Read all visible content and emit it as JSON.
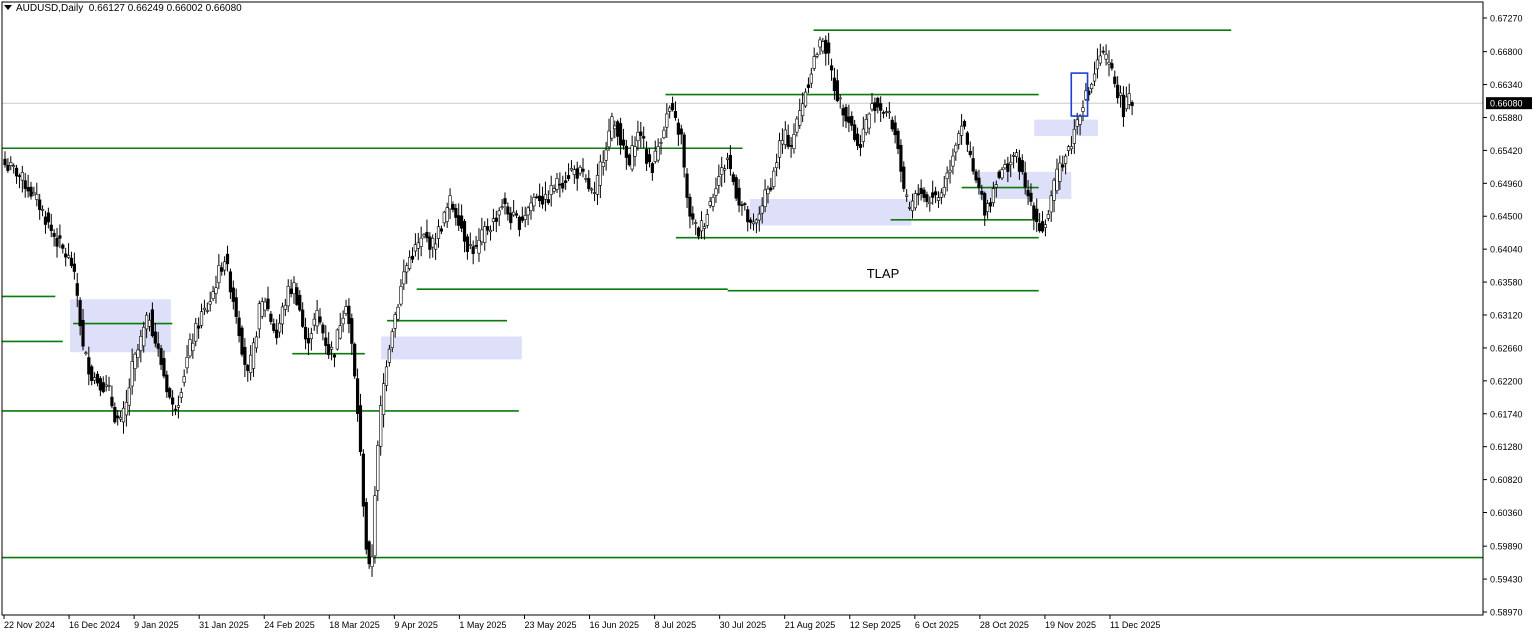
{
  "header": {
    "symbol": "AUDUSD,Daily",
    "ohlc": "0.66127 0.66249 0.66002 0.66080"
  },
  "colors": {
    "level_line": "#0a7a0a",
    "zone_fill": "#dde0f8",
    "candle": "#000000",
    "marker_box": "#1f3fd4",
    "axis": "#000000",
    "price_label_bg": "#000000",
    "price_label_text": "#ffffff",
    "current_price_line": "#c0c0c0"
  },
  "chart_data": {
    "type": "candlestick",
    "symbol": "AUDUSD",
    "timeframe": "Daily",
    "current_price": 0.6608,
    "ylim": [
      0.5897,
      0.6727
    ],
    "y_ticks": [
      0.6727,
      0.668,
      0.6634,
      0.6588,
      0.6542,
      0.6496,
      0.645,
      0.6404,
      0.6358,
      0.6312,
      0.6266,
      0.622,
      0.6174,
      0.6128,
      0.6082,
      0.6036,
      0.5989,
      0.5943,
      0.5897
    ],
    "y_tick_labels": [
      "0.67270",
      "0.66800",
      "0.66340",
      "0.65880",
      "0.65420",
      "0.64960",
      "0.64500",
      "0.64040",
      "0.63580",
      "0.63120",
      "0.62660",
      "0.62200",
      "0.61740",
      "0.61280",
      "0.60820",
      "0.60360",
      "0.59890",
      "0.59430",
      "0.58970"
    ],
    "x_labels": [
      "22 Nov 2024",
      "16 Dec 2024",
      "9 Jan 2025",
      "31 Jan 2025",
      "24 Feb 2025",
      "18 Mar 2025",
      "9 Apr 2025",
      "1 May 2025",
      "23 May 2025",
      "16 Jun 2025",
      "8 Jul 2025",
      "30 Jul 2025",
      "21 Aug 2025",
      "12 Sep 2025",
      "6 Oct 2025",
      "28 Oct 2025",
      "19 Nov 2025",
      "11 Dec 2025"
    ],
    "annotation": "TLAP",
    "close_anchors": [
      [
        0,
        0.6522
      ],
      [
        4,
        0.6512
      ],
      [
        8,
        0.649
      ],
      [
        12,
        0.6465
      ],
      [
        16,
        0.643
      ],
      [
        20,
        0.6402
      ],
      [
        23,
        0.6384
      ],
      [
        25,
        0.634
      ],
      [
        27,
        0.6264
      ],
      [
        30,
        0.6228
      ],
      [
        33,
        0.6218
      ],
      [
        36,
        0.6204
      ],
      [
        38,
        0.6172
      ],
      [
        40,
        0.616
      ],
      [
        42,
        0.6186
      ],
      [
        44,
        0.6238
      ],
      [
        46,
        0.6262
      ],
      [
        48,
        0.629
      ],
      [
        50,
        0.6312
      ],
      [
        52,
        0.6275
      ],
      [
        54,
        0.6245
      ],
      [
        56,
        0.6212
      ],
      [
        58,
        0.6182
      ],
      [
        60,
        0.6196
      ],
      [
        62,
        0.6232
      ],
      [
        64,
        0.6268
      ],
      [
        66,
        0.629
      ],
      [
        68,
        0.6312
      ],
      [
        70,
        0.6322
      ],
      [
        72,
        0.6344
      ],
      [
        74,
        0.6372
      ],
      [
        76,
        0.6392
      ],
      [
        78,
        0.6354
      ],
      [
        80,
        0.6316
      ],
      [
        82,
        0.6268
      ],
      [
        84,
        0.6226
      ],
      [
        86,
        0.6264
      ],
      [
        88,
        0.6318
      ],
      [
        90,
        0.6334
      ],
      [
        92,
        0.6306
      ],
      [
        94,
        0.6282
      ],
      [
        96,
        0.6318
      ],
      [
        98,
        0.6344
      ],
      [
        100,
        0.6352
      ],
      [
        102,
        0.632
      ],
      [
        104,
        0.6272
      ],
      [
        106,
        0.6292
      ],
      [
        108,
        0.6312
      ],
      [
        110,
        0.6288
      ],
      [
        112,
        0.6262
      ],
      [
        114,
        0.6262
      ],
      [
        116,
        0.6304
      ],
      [
        118,
        0.6332
      ],
      [
        120,
        0.6268
      ],
      [
        122,
        0.6178
      ],
      [
        124,
        0.6052
      ],
      [
        125,
        0.5988
      ],
      [
        126,
        0.5955
      ],
      [
        127,
        0.5978
      ],
      [
        128,
        0.6066
      ],
      [
        130,
        0.618
      ],
      [
        132,
        0.6248
      ],
      [
        134,
        0.6296
      ],
      [
        136,
        0.633
      ],
      [
        138,
        0.637
      ],
      [
        140,
        0.6392
      ],
      [
        142,
        0.6404
      ],
      [
        145,
        0.642
      ],
      [
        148,
        0.641
      ],
      [
        151,
        0.6438
      ],
      [
        154,
        0.647
      ],
      [
        157,
        0.6448
      ],
      [
        160,
        0.641
      ],
      [
        163,
        0.6402
      ],
      [
        166,
        0.643
      ],
      [
        169,
        0.6442
      ],
      [
        172,
        0.6468
      ],
      [
        175,
        0.6448
      ],
      [
        178,
        0.6442
      ],
      [
        181,
        0.6462
      ],
      [
        184,
        0.6482
      ],
      [
        187,
        0.647
      ],
      [
        190,
        0.6492
      ],
      [
        193,
        0.65
      ],
      [
        196,
        0.6514
      ],
      [
        199,
        0.651
      ],
      [
        202,
        0.649
      ],
      [
        204,
        0.6475
      ],
      [
        206,
        0.652
      ],
      [
        208,
        0.6552
      ],
      [
        210,
        0.658
      ],
      [
        212,
        0.6572
      ],
      [
        214,
        0.654
      ],
      [
        216,
        0.652
      ],
      [
        218,
        0.6558
      ],
      [
        220,
        0.6568
      ],
      [
        222,
        0.653
      ],
      [
        224,
        0.652
      ],
      [
        226,
        0.6548
      ],
      [
        228,
        0.6578
      ],
      [
        230,
        0.66
      ],
      [
        232,
        0.658
      ],
      [
        234,
        0.656
      ],
      [
        236,
        0.647
      ],
      [
        238,
        0.644
      ],
      [
        240,
        0.6428
      ],
      [
        242,
        0.6445
      ],
      [
        244,
        0.647
      ],
      [
        246,
        0.6498
      ],
      [
        248,
        0.6512
      ],
      [
        250,
        0.6532
      ],
      [
        252,
        0.6498
      ],
      [
        254,
        0.6472
      ],
      [
        256,
        0.6458
      ],
      [
        258,
        0.6432
      ],
      [
        260,
        0.644
      ],
      [
        262,
        0.647
      ],
      [
        264,
        0.6485
      ],
      [
        266,
        0.651
      ],
      [
        268,
        0.655
      ],
      [
        270,
        0.656
      ],
      [
        272,
        0.6552
      ],
      [
        274,
        0.658
      ],
      [
        276,
        0.6612
      ],
      [
        278,
        0.664
      ],
      [
        280,
        0.667
      ],
      [
        282,
        0.6688
      ],
      [
        283,
        0.6701
      ],
      [
        285,
        0.6668
      ],
      [
        287,
        0.6632
      ],
      [
        289,
        0.6608
      ],
      [
        291,
        0.6594
      ],
      [
        293,
        0.6578
      ],
      [
        295,
        0.6545
      ],
      [
        297,
        0.6568
      ],
      [
        299,
        0.6594
      ],
      [
        301,
        0.6608
      ],
      [
        303,
        0.6602
      ],
      [
        305,
        0.6596
      ],
      [
        307,
        0.6578
      ],
      [
        309,
        0.655
      ],
      [
        311,
        0.6478
      ],
      [
        313,
        0.646
      ],
      [
        315,
        0.6475
      ],
      [
        317,
        0.6488
      ],
      [
        319,
        0.647
      ],
      [
        321,
        0.648
      ],
      [
        323,
        0.6476
      ],
      [
        325,
        0.6495
      ],
      [
        327,
        0.6522
      ],
      [
        329,
        0.6556
      ],
      [
        331,
        0.6582
      ],
      [
        333,
        0.6548
      ],
      [
        335,
        0.651
      ],
      [
        337,
        0.6486
      ],
      [
        339,
        0.6462
      ],
      [
        341,
        0.6472
      ],
      [
        343,
        0.6505
      ],
      [
        345,
        0.651
      ],
      [
        347,
        0.6522
      ],
      [
        349,
        0.6535
      ],
      [
        351,
        0.6522
      ],
      [
        353,
        0.6486
      ],
      [
        355,
        0.647
      ],
      [
        357,
        0.6445
      ],
      [
        359,
        0.643
      ],
      [
        361,
        0.6455
      ],
      [
        363,
        0.649
      ],
      [
        365,
        0.6522
      ],
      [
        367,
        0.6535
      ],
      [
        369,
        0.6554
      ],
      [
        371,
        0.6585
      ],
      [
        373,
        0.6612
      ],
      [
        375,
        0.6622
      ],
      [
        377,
        0.665
      ],
      [
        379,
        0.6675
      ],
      [
        381,
        0.6668
      ],
      [
        383,
        0.665
      ],
      [
        385,
        0.6625
      ],
      [
        387,
        0.66
      ],
      [
        389,
        0.6612
      ],
      [
        390,
        0.6608
      ]
    ],
    "levels": [
      {
        "price": 0.671,
        "x0": 0.548,
        "x1": 0.83
      },
      {
        "price": 0.662,
        "x0": 0.448,
        "x1": 0.7
      },
      {
        "price": 0.6545,
        "x0": 0.0,
        "x1": 0.5
      },
      {
        "price": 0.649,
        "x0": 0.648,
        "x1": 0.7
      },
      {
        "price": 0.6445,
        "x0": 0.6,
        "x1": 0.7
      },
      {
        "price": 0.642,
        "x0": 0.455,
        "x1": 0.7
      },
      {
        "price": 0.6348,
        "x0": 0.28,
        "x1": 0.49
      },
      {
        "price": 0.6346,
        "x0": 0.49,
        "x1": 0.7
      },
      {
        "price": 0.6338,
        "x0": 0.0,
        "x1": 0.036
      },
      {
        "price": 0.6304,
        "x0": 0.26,
        "x1": 0.341
      },
      {
        "price": 0.63,
        "x0": 0.048,
        "x1": 0.115
      },
      {
        "price": 0.6275,
        "x0": 0.0,
        "x1": 0.041
      },
      {
        "price": 0.6258,
        "x0": 0.196,
        "x1": 0.245
      },
      {
        "price": 0.6178,
        "x0": 0.0,
        "x1": 0.349
      },
      {
        "price": 0.5973,
        "x0": 0.0,
        "x1": 1.0
      }
    ],
    "zones": [
      {
        "p_top": 0.6585,
        "p_bot": 0.6562,
        "x0": 0.697,
        "x1": 0.74
      },
      {
        "p_top": 0.6512,
        "p_bot": 0.6474,
        "x0": 0.66,
        "x1": 0.722
      },
      {
        "p_top": 0.6474,
        "p_bot": 0.6437,
        "x0": 0.505,
        "x1": 0.614
      },
      {
        "p_top": 0.6334,
        "p_bot": 0.626,
        "x0": 0.046,
        "x1": 0.114
      },
      {
        "p_top": 0.6282,
        "p_bot": 0.625,
        "x0": 0.256,
        "x1": 0.351
      }
    ],
    "marker_box": {
      "p_top": 0.665,
      "p_bot": 0.659,
      "x0": 0.722,
      "x1": 0.733
    }
  }
}
